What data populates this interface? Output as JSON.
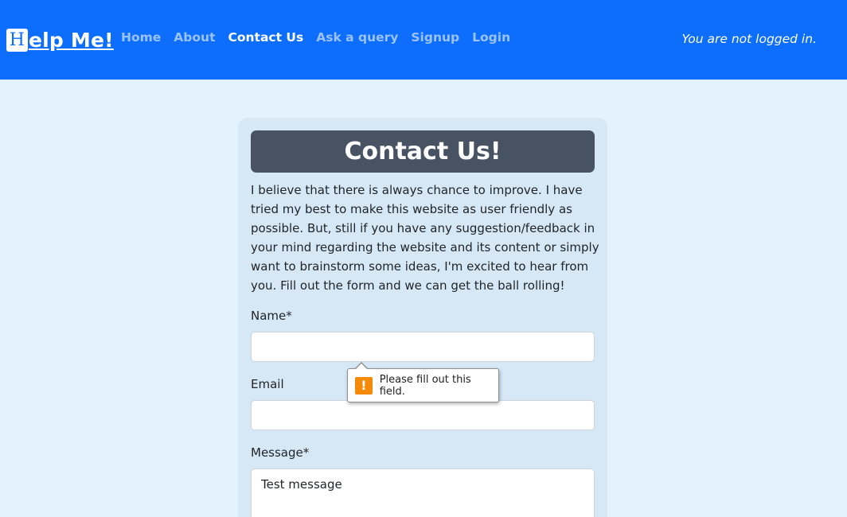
{
  "navbar": {
    "brand_initial": "H",
    "brand_rest": "elp Me!",
    "links": [
      "Home",
      "About",
      "Contact Us",
      "Ask a query",
      "Signup",
      "Login"
    ],
    "active_link": "Contact Us",
    "status": "You are not logged in."
  },
  "card": {
    "title": "Contact Us!",
    "intro": "I believe that there is always chance to improve. I have tried my best to make this website as user friendly as possible. But, still if you have any suggestion/feedback in your mind regarding the website and its content or simply want to brainstorm some ideas, I'm excited to hear from you. Fill out the form and we can get the ball rolling!",
    "name_label": "Name*",
    "name_value": "",
    "email_label": "Email",
    "email_value": "",
    "message_label": "Message*",
    "message_value": "Test message"
  },
  "validation_tooltip": {
    "icon": "warning-icon",
    "icon_glyph": "!",
    "text": "Please fill out this field."
  },
  "colors": {
    "navbar": "#0d6efd",
    "page_background": "#e3f2fd",
    "card_background": "#d6e8f6",
    "title_background": "#475263",
    "warning": "#f48a08"
  }
}
